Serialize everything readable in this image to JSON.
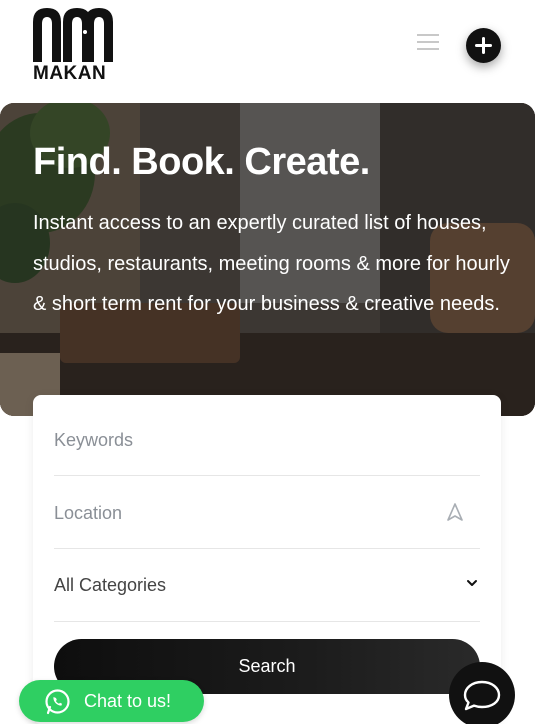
{
  "brand": {
    "logo_text": "MAKAN"
  },
  "header": {
    "menu_icon": "hamburger-icon",
    "add_icon": "plus-icon"
  },
  "hero": {
    "title": "Find. Book. Create.",
    "subtitle": "Instant access to an expertly curated list of houses, studios, restaurants, meeting rooms & more for hourly & short term rent for your business & creative needs."
  },
  "search": {
    "keywords_placeholder": "Keywords",
    "location_placeholder": "Location",
    "category_value": "All Categories",
    "button_label": "Search"
  },
  "chat": {
    "whatsapp_label": "Chat to us!",
    "accent": "#2fcf62"
  },
  "colors": {
    "primary": "#111111",
    "whatsapp": "#2fcf62"
  }
}
